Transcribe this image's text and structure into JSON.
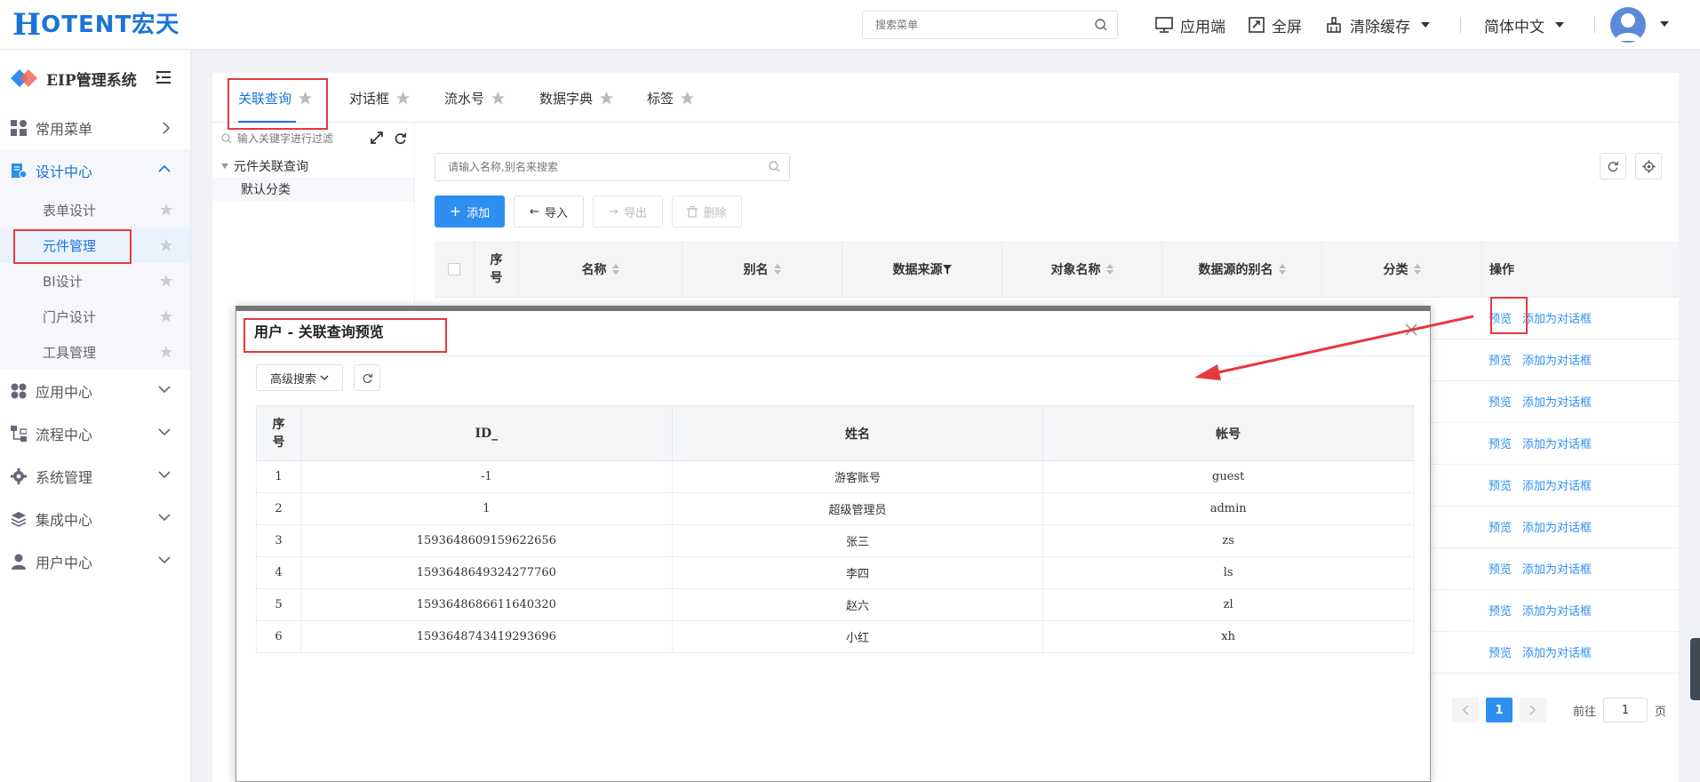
{
  "header": {
    "logo_h": "H",
    "logo_text": "OTENT宏天",
    "search_placeholder": "搜索菜单",
    "actions": {
      "app_end": "应用端",
      "fullscreen": "全屏",
      "clear_cache": "清除缓存",
      "language": "简体中文"
    }
  },
  "sidebar": {
    "system_title": "EIP管理系统",
    "menus": [
      {
        "label": "常用菜单"
      },
      {
        "label": "设计中心"
      },
      {
        "label": "应用中心"
      },
      {
        "label": "流程中心"
      },
      {
        "label": "系统管理"
      },
      {
        "label": "集成中心"
      },
      {
        "label": "用户中心"
      }
    ],
    "design_sub": [
      {
        "label": "表单设计"
      },
      {
        "label": "元件管理"
      },
      {
        "label": "BI设计"
      },
      {
        "label": "门户设计"
      },
      {
        "label": "工具管理"
      }
    ]
  },
  "tabs": [
    {
      "label": "关联查询"
    },
    {
      "label": "对话框"
    },
    {
      "label": "流水号"
    },
    {
      "label": "数据字典"
    },
    {
      "label": "标签"
    }
  ],
  "tree": {
    "filter_placeholder": "输入关键字进行过滤",
    "root": "元件关联查询",
    "child": "默认分类"
  },
  "list": {
    "search_placeholder": "请输入名称,别名来搜索",
    "buttons": {
      "add": "添加",
      "import": "导入",
      "export": "导出",
      "delete": "删除"
    },
    "columns": {
      "index": "序号",
      "name": "名称",
      "alias": "别名",
      "datasource": "数据来源",
      "object_name": "对象名称",
      "ds_alias": "数据源的别名",
      "category": "分类",
      "operation": "操作"
    },
    "row_ops": {
      "preview": "预览",
      "add_dialog": "添加为对话框"
    }
  },
  "pagination": {
    "current_page": "1",
    "goto_label": "前往",
    "goto_value": "1",
    "page_suffix": "页"
  },
  "dialog": {
    "title": "用户 - 关联查询预览",
    "advanced_search": "高级搜索",
    "columns": {
      "index": "序号",
      "id": "ID_",
      "name": "姓名",
      "account": "帐号"
    },
    "rows": [
      {
        "index": "1",
        "id": "-1",
        "name": "游客账号",
        "account": "guest"
      },
      {
        "index": "2",
        "id": "1",
        "name": "超级管理员",
        "account": "admin"
      },
      {
        "index": "3",
        "id": "1593648609159622656",
        "name": "张三",
        "account": "zs"
      },
      {
        "index": "4",
        "id": "1593648649324277760",
        "name": "李四",
        "account": "ls"
      },
      {
        "index": "5",
        "id": "1593648686611640320",
        "name": "赵六",
        "account": "zl"
      },
      {
        "index": "6",
        "id": "1593648743419293696",
        "name": "小红",
        "account": "xh"
      }
    ]
  },
  "colors": {
    "accent": "#2e8ff0",
    "highlight": "#e8383d"
  }
}
